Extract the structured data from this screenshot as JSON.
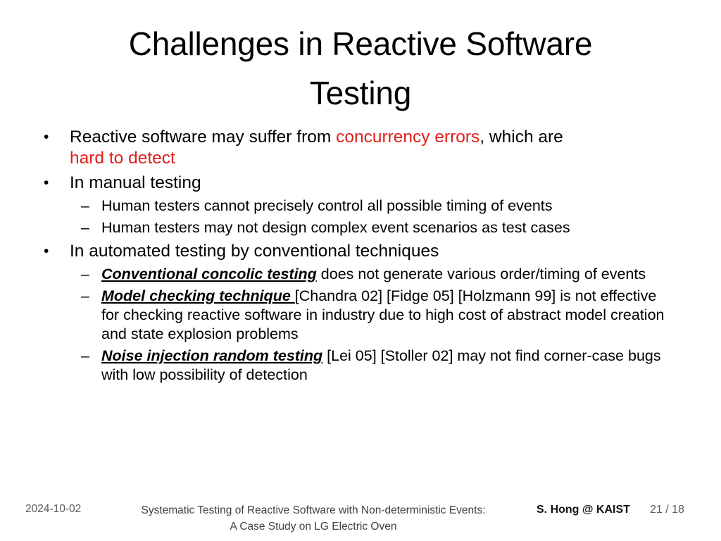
{
  "slide": {
    "title_line1": "Challenges in Reactive Software",
    "title_line2": "Testing",
    "bullets": {
      "b1_pre": "Reactive software may suffer from ",
      "b1_red1": "concurrency errors",
      "b1_mid": ", which are",
      "b1_red2": "hard to detect",
      "b2": "In manual testing",
      "b2_sub1": "Human testers cannot precisely control all possible timing of events",
      "b2_sub2": "Human testers may not design complex event scenarios as test cases",
      "b3": "In automated testing by conventional techniques",
      "b3_sub1_term": "Conventional concolic testing",
      "b3_sub1_rest": " does not generate various order/timing of events",
      "b3_sub2_term": "Model checking technique ",
      "b3_sub2_rest": "[Chandra 02] [Fidge 05] [Holzmann 99] is not effective for checking reactive software in industry due to high cost of abstract model creation and state explosion problems",
      "b3_sub3_term": "Noise injection random testing",
      "b3_sub3_rest": " [Lei 05] [Stoller 02] may not find corner-case bugs with low possibility of detection"
    },
    "markers": {
      "level1": "•",
      "level2": "–"
    }
  },
  "footer": {
    "date": "2024-10-02",
    "title_line1": "Systematic Testing of Reactive Software with Non-deterministic Events:",
    "title_line2": "A Case Study on LG Electric Oven",
    "author": "S. Hong @ KAIST",
    "page": "21 / 18"
  },
  "colors": {
    "accent_red": "#df1f1a",
    "text": "#000000",
    "footer_gray": "#5a5a5a"
  }
}
